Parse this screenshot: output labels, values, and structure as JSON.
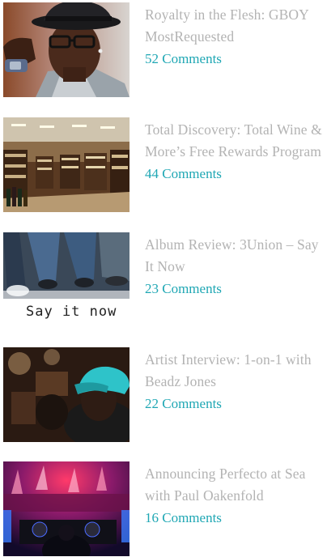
{
  "posts": [
    {
      "title": "Royalty in the Flesh: GBOY MostRequested",
      "comments": "52 Comments",
      "thumbnail_alt": "Portrait of a young man in a black cap and glasses"
    },
    {
      "title": "Total Discovery: Total Wine & More’s Free Rewards Program",
      "comments": "44 Comments",
      "thumbnail_alt": "Interior of a wine store with long aisles"
    },
    {
      "title": "Album Review: 3Union – Say It Now",
      "comments": "23 Comments",
      "thumbnail_alt": "Album cover showing people sitting",
      "thumbnail_text": "Say it now"
    },
    {
      "title": "Artist Interview: 1-on-1 with Beadz Jones",
      "comments": "22 Comments",
      "thumbnail_alt": "Man in a teal cap in a dim room"
    },
    {
      "title": "Announcing Perfecto at Sea with Paul Oakenfold",
      "comments": "16 Comments",
      "thumbnail_alt": "DJ performing to a crowd under red and blue lights"
    }
  ],
  "colors": {
    "title": "#b3b3b3",
    "comments": "#1fa7b4"
  }
}
